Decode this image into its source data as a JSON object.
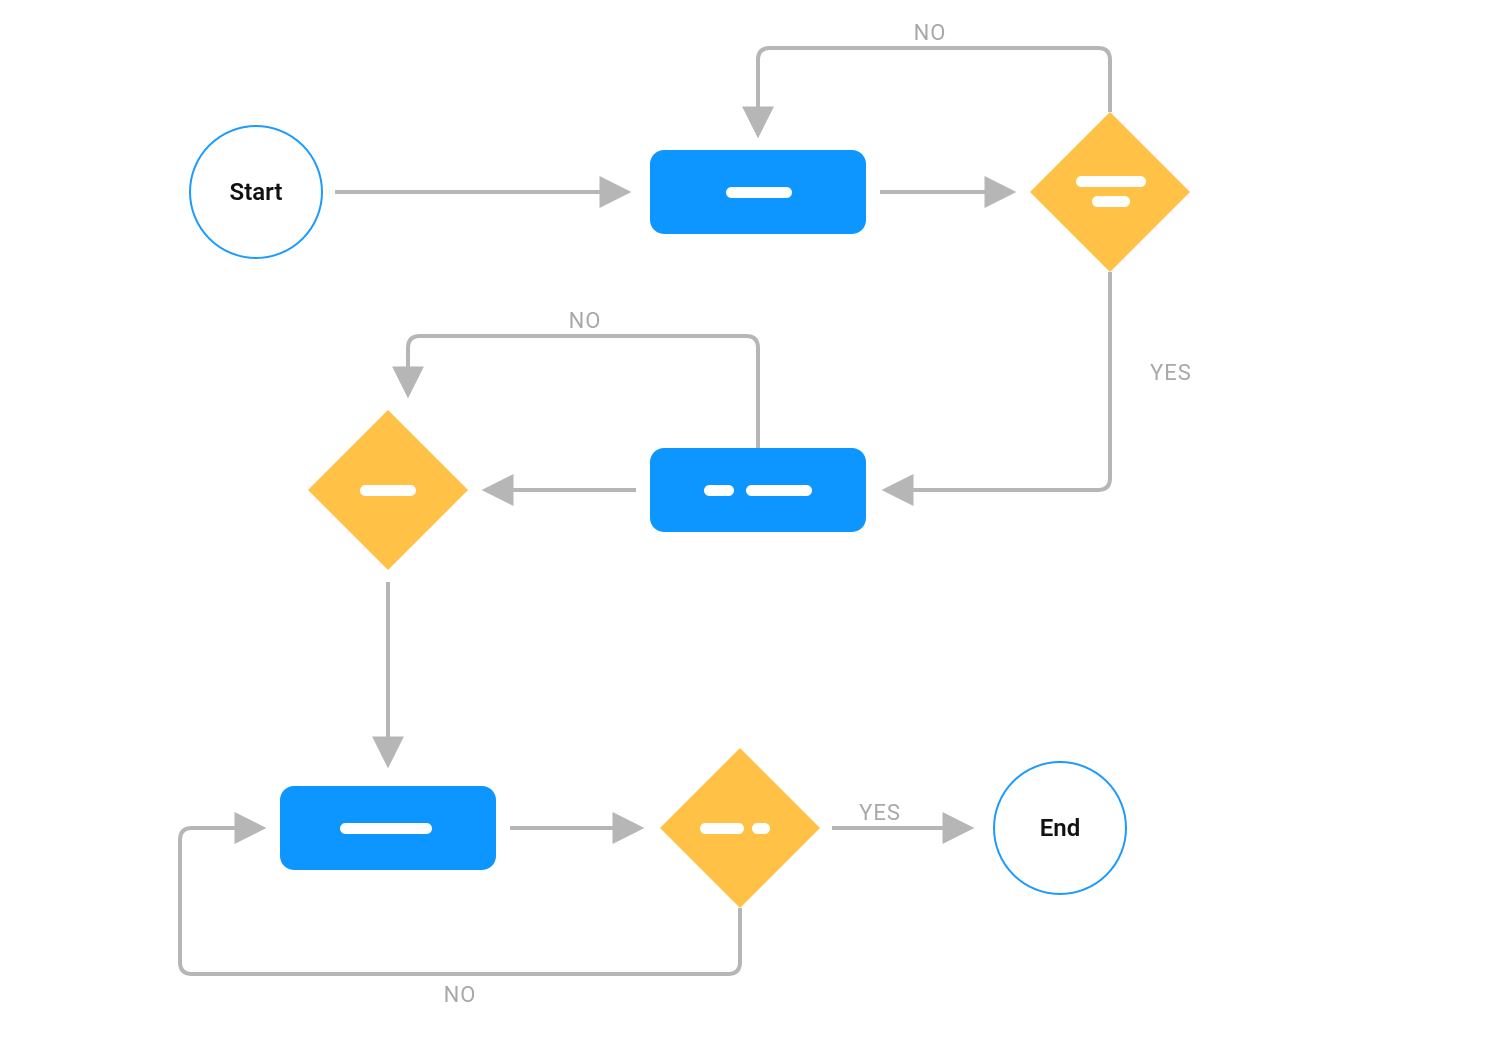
{
  "flowchart": {
    "nodes": {
      "start": {
        "type": "terminal",
        "label": "Start"
      },
      "end": {
        "type": "terminal",
        "label": "End"
      },
      "proc1": {
        "type": "process"
      },
      "proc2": {
        "type": "process"
      },
      "proc3": {
        "type": "process"
      },
      "dec1": {
        "type": "decision"
      },
      "dec2": {
        "type": "decision"
      },
      "dec3": {
        "type": "decision"
      }
    },
    "edges": [
      {
        "from": "start",
        "to": "proc1",
        "label": ""
      },
      {
        "from": "proc1",
        "to": "dec1",
        "label": ""
      },
      {
        "from": "dec1",
        "to": "proc1",
        "label": "NO"
      },
      {
        "from": "dec1",
        "to": "proc2",
        "label": "YES"
      },
      {
        "from": "proc2",
        "to": "dec2",
        "label": ""
      },
      {
        "from": "dec2",
        "to": "proc2",
        "label": "NO"
      },
      {
        "from": "dec2",
        "to": "proc3",
        "label": ""
      },
      {
        "from": "proc3",
        "to": "dec3",
        "label": ""
      },
      {
        "from": "dec3",
        "to": "end",
        "label": "YES"
      },
      {
        "from": "dec3",
        "to": "proc3",
        "label": "NO"
      }
    ],
    "labels": {
      "yes": "YES",
      "no": "NO"
    },
    "colors": {
      "terminal_stroke": "#1a9bff",
      "process_fill": "#0d96ff",
      "decision_fill": "#ffc247",
      "connector": "#b6b6b6",
      "text_dark": "#111111",
      "text_muted": "#a8a8a8",
      "placeholder_light": "#ffffff"
    }
  }
}
